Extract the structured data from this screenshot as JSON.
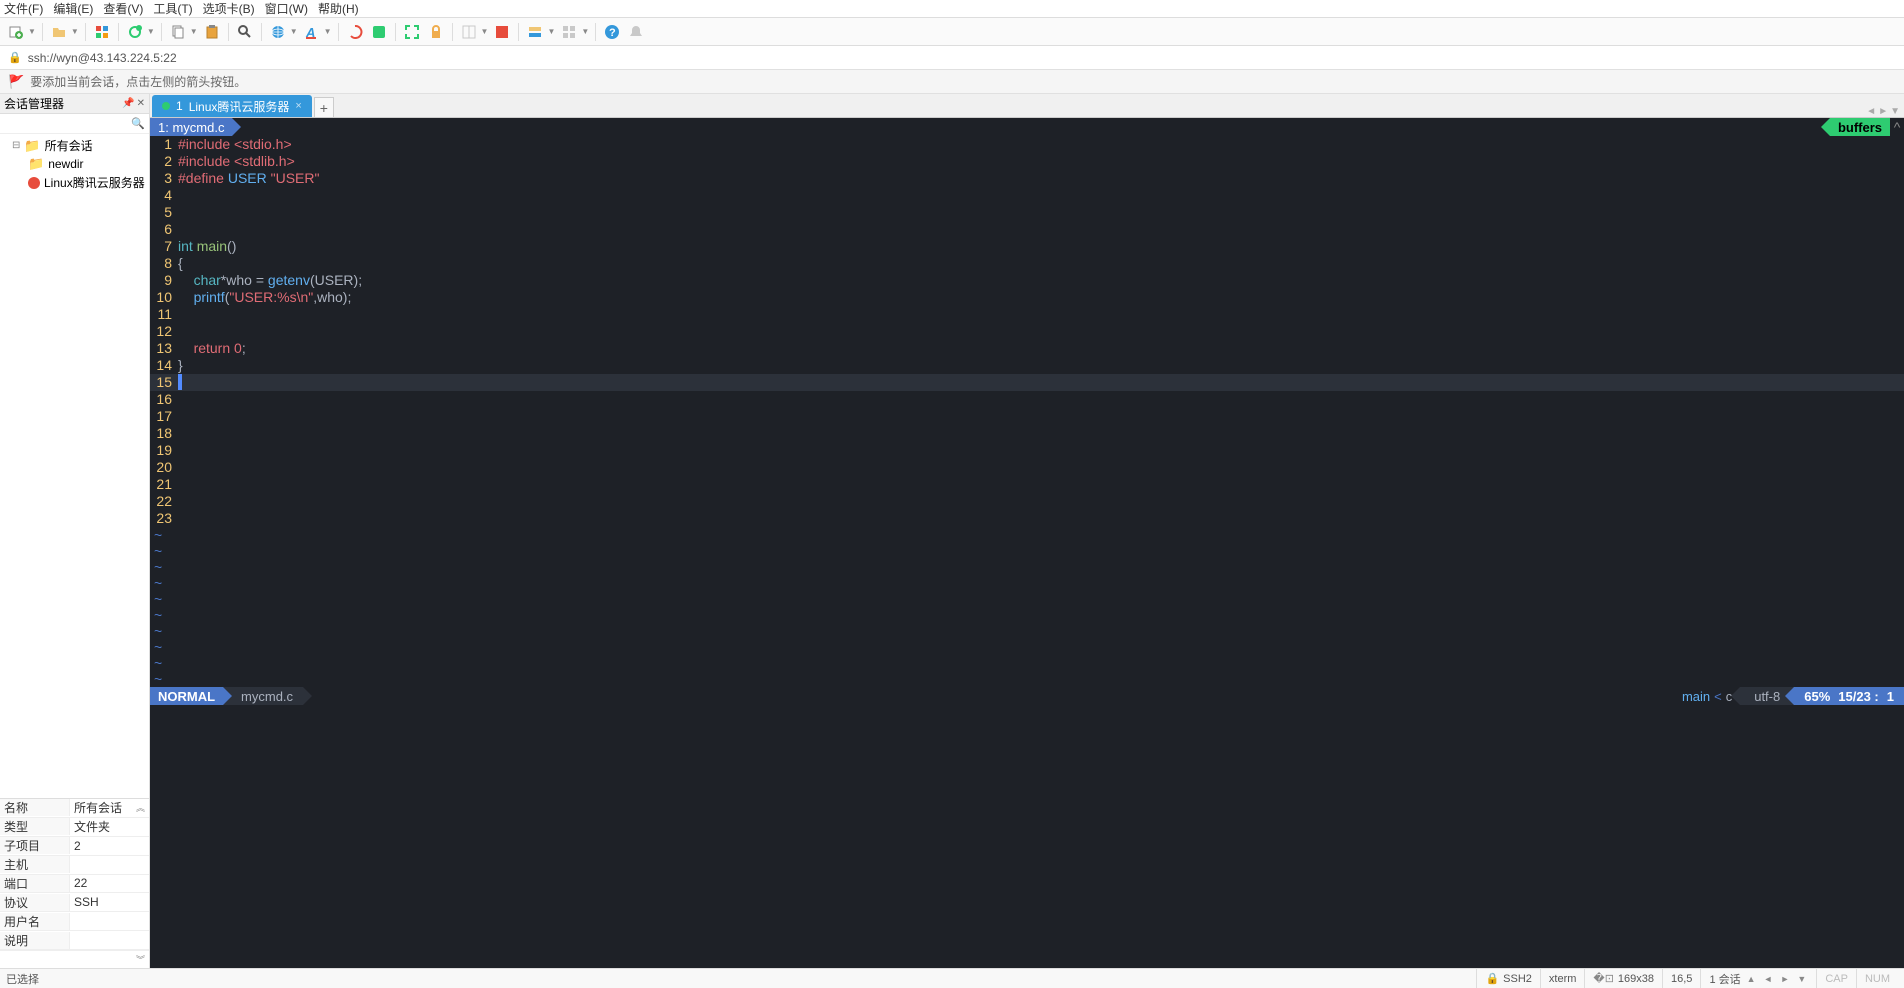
{
  "menu": [
    "文件(F)",
    "编辑(E)",
    "查看(V)",
    "工具(T)",
    "选项卡(B)",
    "窗口(W)",
    "帮助(H)"
  ],
  "address": "ssh://wyn@43.143.224.5:22",
  "infobar_text": "要添加当前会话，点击左侧的箭头按钮。",
  "sidebar": {
    "title": "会话管理器",
    "tree": [
      {
        "label": "所有会话",
        "icon": "folder",
        "indent": 0
      },
      {
        "label": "newdir",
        "icon": "folder",
        "indent": 1
      },
      {
        "label": "Linux腾讯云服务器",
        "icon": "server",
        "indent": 1
      }
    ],
    "props": [
      {
        "label": "名称",
        "value": "所有会话"
      },
      {
        "label": "类型",
        "value": "文件夹"
      },
      {
        "label": "子项目",
        "value": "2"
      },
      {
        "label": "主机",
        "value": ""
      },
      {
        "label": "端口",
        "value": "22"
      },
      {
        "label": "协议",
        "value": "SSH"
      },
      {
        "label": "用户名",
        "value": ""
      },
      {
        "label": "说明",
        "value": ""
      }
    ]
  },
  "tab": {
    "index": "1",
    "label": "Linux腾讯云服务器"
  },
  "editor": {
    "buffer_tab": "1: mycmd.c",
    "buffers_label": "buffers",
    "lines": [
      {
        "n": "1",
        "html": "<span class='c-include'>#include</span> <span class='c-header'>&lt;stdio.h&gt;</span>"
      },
      {
        "n": "2",
        "html": "<span class='c-include'>#include</span> <span class='c-header'>&lt;stdlib.h&gt;</span>"
      },
      {
        "n": "3",
        "html": "<span class='c-define'>#define</span> <span class='c-macro'>USER</span> <span class='c-string'>\"USER\"</span>"
      },
      {
        "n": "4",
        "html": ""
      },
      {
        "n": "5",
        "html": ""
      },
      {
        "n": "6",
        "html": ""
      },
      {
        "n": "7",
        "html": "<span class='c-type'>int</span> <span class='c-funcname'>main</span><span class='c-punct'>()</span>"
      },
      {
        "n": "8",
        "html": "<span class='c-punct'>{</span>"
      },
      {
        "n": "9",
        "html": "    <span class='c-type'>char</span><span class='c-punct'>*</span><span class='c-ident'>who</span> <span class='c-punct'>=</span> <span class='c-func'>getenv</span><span class='c-punct'>(</span><span class='c-ident'>USER</span><span class='c-punct'>);</span>"
      },
      {
        "n": "10",
        "html": "    <span class='c-func'>printf</span><span class='c-punct'>(</span><span class='c-string'>\"USER:%s\\n\"</span><span class='c-punct'>,</span><span class='c-ident'>who</span><span class='c-punct'>);</span>"
      },
      {
        "n": "11",
        "html": ""
      },
      {
        "n": "12",
        "html": ""
      },
      {
        "n": "13",
        "html": "    <span class='c-keyword'>return</span> <span class='c-num'>0</span><span class='c-punct'>;</span>"
      },
      {
        "n": "14",
        "html": "<span class='c-punct'>}</span>"
      },
      {
        "n": "15",
        "html": "<span class='cursor-block'>&nbsp;</span>",
        "current": true
      },
      {
        "n": "16",
        "html": ""
      },
      {
        "n": "17",
        "html": ""
      },
      {
        "n": "18",
        "html": ""
      },
      {
        "n": "19",
        "html": ""
      },
      {
        "n": "20",
        "html": ""
      },
      {
        "n": "21",
        "html": ""
      },
      {
        "n": "22",
        "html": ""
      },
      {
        "n": "23",
        "html": ""
      }
    ],
    "tilde_count": 10,
    "status": {
      "mode": "NORMAL",
      "file": "mycmd.c",
      "branch": "main",
      "filetype": "c",
      "encoding": "utf-8",
      "percent": "65%",
      "position": "15/23",
      "col": "1"
    }
  },
  "statusbar": {
    "left": "已选择",
    "proto": "SSH2",
    "term": "xterm",
    "size": "169x38",
    "cursor": "16,5",
    "sessions": "1 会话",
    "caps": "CAP",
    "num": "NUM"
  }
}
